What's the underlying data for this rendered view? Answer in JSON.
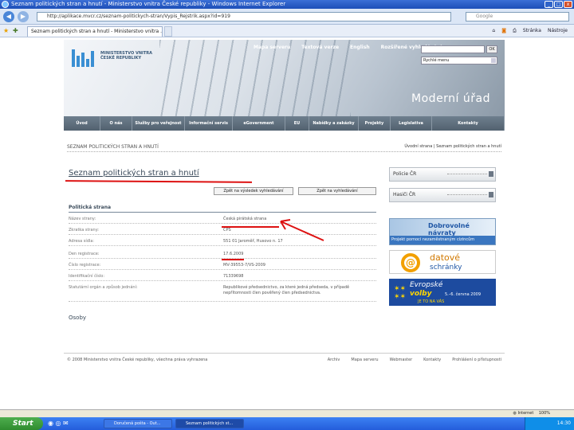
{
  "window": {
    "title": "Seznam politických stran a hnutí - Ministerstvo vnitra České republiky - Windows Internet Explorer",
    "buttons": {
      "min": "_",
      "max": "□",
      "close": "x"
    }
  },
  "browser": {
    "url": "http://aplikace.mvcr.cz/seznam-politickych-stran/Vypis_Rejstrik.aspx?id=919",
    "search_placeholder": "Google",
    "tab_label": "Seznam politických stran a hnutí - Ministerstvo vnitra ...",
    "commands": [
      "Stránka",
      "Nástroje"
    ]
  },
  "site": {
    "logo_text": "MINISTERSTVO VNITRA ČESKÉ REPUBLIKY",
    "top_nav": [
      "Mapa serveru",
      "Textová verze",
      "English",
      "Rozšířené vyhledávání"
    ],
    "search_ok": "OK",
    "quick_menu": "Rychlé menu",
    "slogan": "Moderní úřad",
    "main_nav": [
      "Úvod",
      "O nás",
      "Služby pro veřejnost",
      "Informační servis",
      "eGovernment",
      "EU",
      "Nabídky a zakázky",
      "Projekty",
      "Legislativa",
      "Kontakty"
    ],
    "section_header": "Seznam politických stran a hnutí",
    "breadcrumb": "Úvodní strana  |  Seznam politických stran a hnutí",
    "page_title": "Seznam politických stran a hnutí",
    "btn_results": "Zpět na výsledek vyhledávání",
    "btn_search": "Zpět na vyhledávání",
    "detail_heading": "Politická strana",
    "rows": [
      {
        "label": "Název strany:",
        "value": "Česká pirátská strana"
      },
      {
        "label": "Zkratka strany:",
        "value": "ČPS"
      },
      {
        "label": "Adresa sídla:",
        "value": "551 01 Jaroměř, Husovo n. 17"
      },
      {
        "label": "Den registrace:",
        "value": "17.6.2009"
      },
      {
        "label": "Číslo registrace:",
        "value": "MV-39553-7/VS-2009"
      },
      {
        "label": "Identifikační číslo:",
        "value": "71339698"
      },
      {
        "label": "Statutární orgán a způsob jednání:",
        "value": "Republikové předsednictvo, za které jedná předseda, v případě nepřítomnosti člen pověřený člen předsednictva."
      }
    ],
    "osoby": "Osoby",
    "sidebar_boxes": [
      "Policie ČR",
      "Hasiči ČR"
    ],
    "ads": {
      "ad1_title": "Dobrovolné návraty",
      "ad1_sub": "Projekt pomoci nezaměstnaným cizincům",
      "ad2_title": "datové",
      "ad2_sub": "schránky",
      "ad2_symbol": "@",
      "ad3_line1": "Evropské",
      "ad3_line2": "volby",
      "ad3_dates": "5.–6. června 2009",
      "ad3_tag": "JE TO NA VÁS"
    },
    "footer_copy": "© 2008 Ministerstvo vnitra České republiky, všechna práva vyhrazena",
    "footer_links": [
      "Archiv",
      "Mapa serveru",
      "Webmaster",
      "Kontakty",
      "Prohlášení o přístupnosti"
    ]
  },
  "status": {
    "left": "",
    "zone": "Internet",
    "zoom": "100%"
  },
  "taskbar": {
    "start": "Start",
    "tasks": [
      "Doručená pošta - Out...",
      "Seznam politických st..."
    ],
    "clock": "14:30"
  }
}
